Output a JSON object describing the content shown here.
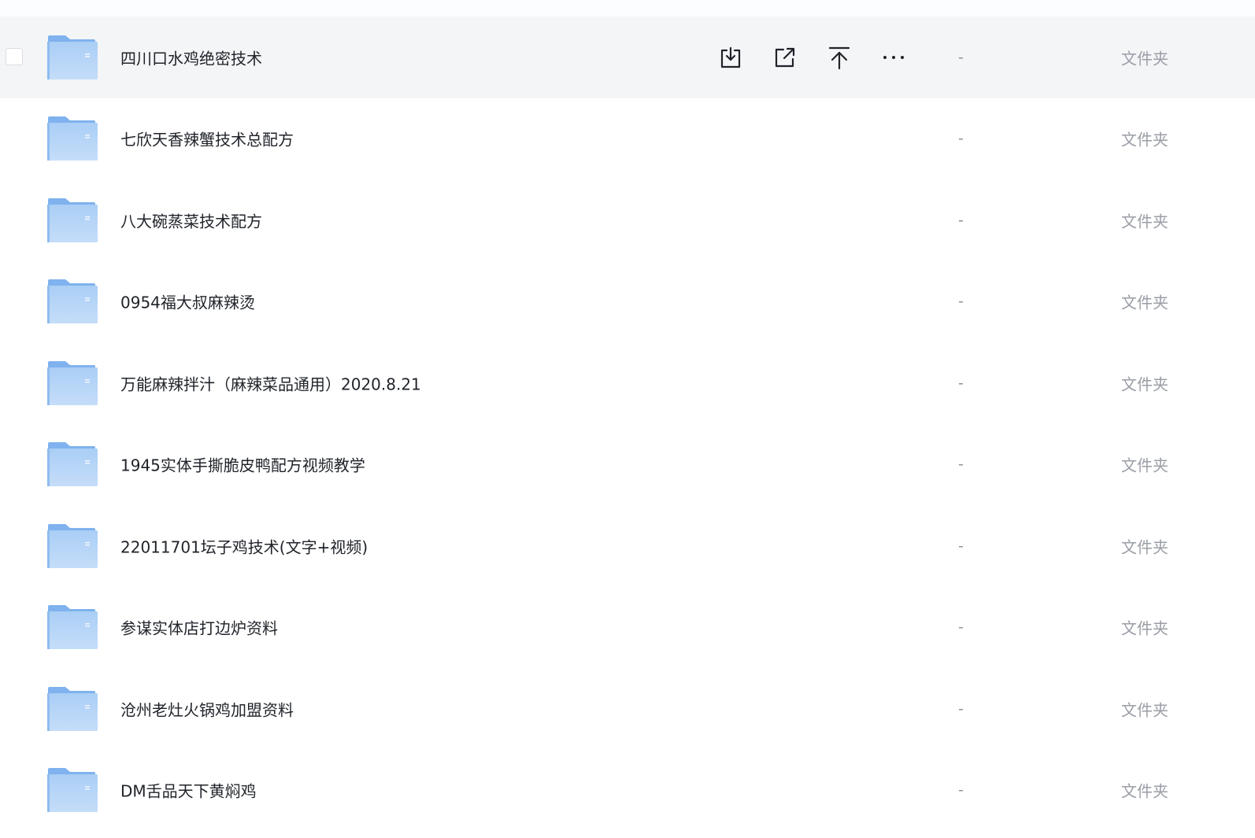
{
  "file_list": {
    "rows": [
      {
        "name": "四川口水鸡绝密技术",
        "size": "-",
        "type": "文件夹",
        "hovered": true
      },
      {
        "name": "七欣天香辣蟹技术总配方",
        "size": "-",
        "type": "文件夹"
      },
      {
        "name": "八大碗蒸菜技术配方",
        "size": "-",
        "type": "文件夹"
      },
      {
        "name": "0954福大叔麻辣烫",
        "size": "-",
        "type": "文件夹"
      },
      {
        "name": "万能麻辣拌汁（麻辣菜品通用）2020.8.21",
        "size": "-",
        "type": "文件夹"
      },
      {
        "name": "1945实体手撕脆皮鸭配方视频教学",
        "size": "-",
        "type": "文件夹"
      },
      {
        "name": "22011701坛子鸡技术(文字+视频)",
        "size": "-",
        "type": "文件夹"
      },
      {
        "name": "参谋实体店打边炉资料",
        "size": "-",
        "type": "文件夹"
      },
      {
        "name": "沧州老灶火锅鸡加盟资料",
        "size": "-",
        "type": "文件夹"
      },
      {
        "name": "DM舌品天下黄焖鸡",
        "size": "-",
        "type": "文件夹"
      }
    ],
    "row_actions": [
      "download-icon",
      "share-icon",
      "pin-to-top-icon",
      "more-icon"
    ],
    "row_icon": "folder-icon"
  },
  "colors": {
    "hover_bg": "#f4f5f7",
    "folder_light": "#b7d6f8",
    "folder_dark": "#7fb2ee",
    "text": "#1f2329",
    "muted": "#9a9ea6"
  }
}
